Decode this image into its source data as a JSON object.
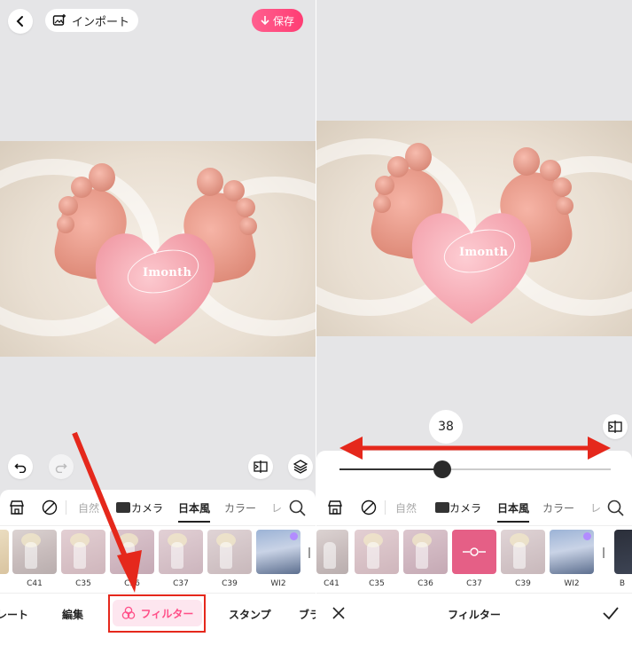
{
  "left": {
    "header": {
      "import_label": "インポート",
      "save_label": "保存"
    },
    "photo": {
      "heart_text": "Imonth"
    },
    "categories": [
      {
        "label": "自然",
        "dim": true
      },
      {
        "label": "カメラ",
        "dim": false
      },
      {
        "label": "日本風",
        "active": true
      },
      {
        "label": "カラー",
        "dim": false
      },
      {
        "label": "レ",
        "dim": true
      }
    ],
    "thumbs": [
      "C41",
      "C35",
      "C36",
      "C37",
      "C39",
      "WI2"
    ],
    "tabs": [
      "レート",
      "編集",
      "フィルター",
      "スタンプ",
      "ブラ"
    ]
  },
  "right": {
    "photo": {
      "heart_text": "Imonth"
    },
    "slider": {
      "value": "38",
      "fraction": 0.38
    },
    "categories": [
      {
        "label": "自然",
        "dim": true
      },
      {
        "label": "カメラ",
        "dim": false
      },
      {
        "label": "日本風",
        "active": true
      },
      {
        "label": "カラー",
        "dim": false
      },
      {
        "label": "レ",
        "dim": true
      }
    ],
    "thumbs": [
      "C41",
      "C35",
      "C36",
      "C37",
      "C39",
      "WI2",
      "B"
    ],
    "bottom": {
      "title": "フィルター"
    }
  },
  "colors": {
    "accent": "#ff4f88",
    "annotation_red": "#e5281c",
    "background": "#e5e5e7"
  }
}
